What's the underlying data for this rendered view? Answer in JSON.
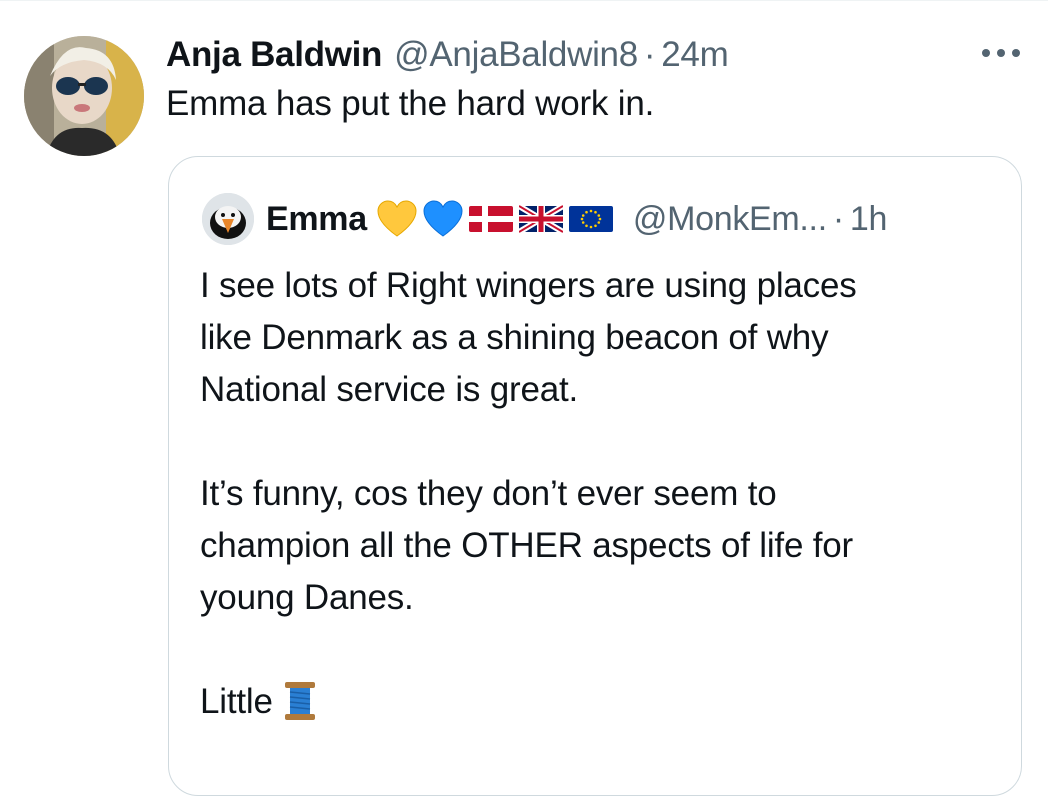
{
  "tweet": {
    "display_name": "Anja Baldwin",
    "handle": "@AnjaBaldwin8",
    "separator": "·",
    "time": "24m",
    "text": "Emma has put the hard work in.",
    "more_icon": "more-horizontal-icon"
  },
  "quoted": {
    "display_name": "Emma",
    "emojis": [
      "yellow-heart",
      "blue-heart",
      "flag-denmark",
      "flag-united-kingdom",
      "flag-european-union"
    ],
    "handle": "@MonkEm...",
    "separator": "·",
    "time": "1h",
    "lines": [
      "I see lots of Right wingers are using places",
      "like Denmark as a shining beacon of why",
      "National service is great.",
      "",
      "It’s funny, cos they don’t ever seem to",
      "champion all the OTHER aspects of life for",
      "young Danes.",
      "",
      "Little"
    ],
    "trailing_emoji": "spool-of-thread-icon"
  },
  "colors": {
    "text": "#0f1419",
    "secondary": "#536471",
    "border": "#cfd9de",
    "yellow_heart": "#ffc83d",
    "blue_heart": "#1e90ff",
    "dk_red": "#c8102e",
    "eu_blue": "#003399"
  }
}
